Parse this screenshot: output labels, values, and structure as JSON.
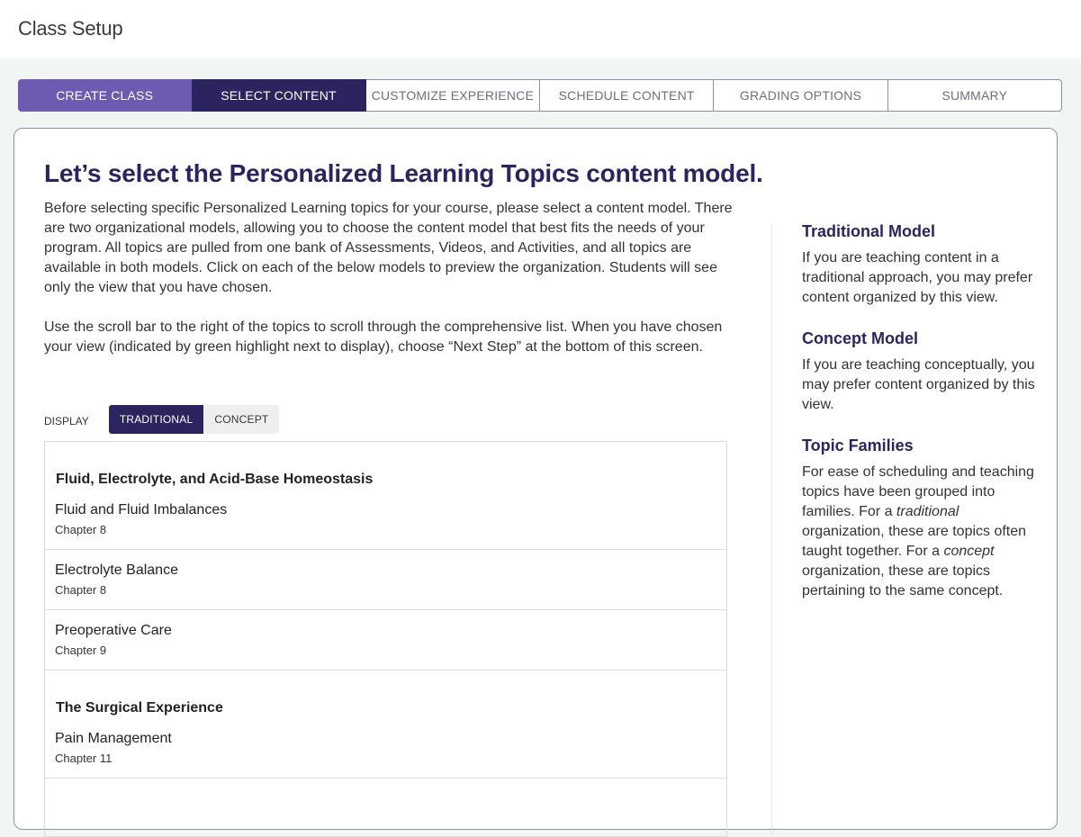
{
  "header": {
    "title": "Class Setup"
  },
  "stepper": {
    "steps": [
      {
        "label": "CREATE CLASS",
        "state": "done"
      },
      {
        "label": "SELECT CONTENT",
        "state": "active"
      },
      {
        "label": "CUSTOMIZE EXPERIENCE",
        "state": "upcoming"
      },
      {
        "label": "SCHEDULE CONTENT",
        "state": "upcoming"
      },
      {
        "label": "GRADING OPTIONS",
        "state": "upcoming"
      },
      {
        "label": "SUMMARY",
        "state": "upcoming"
      }
    ]
  },
  "main": {
    "title": "Let’s select the Personalized Learning Topics content model.",
    "intro_p1": "Before selecting specific Personalized Learning topics for your course, please select a content model. There are two organizational models, allowing you to choose the content model that best fits the needs of your program. All topics are pulled from one bank of Assessments, Videos, and Activities, and all topics are available in both models. Click on each of the below models to preview the  organization. Students will see only the view that you have chosen.",
    "intro_p2": "Use the scroll bar to the right of the topics to scroll through the comprehensive list. When you have chosen your view (indicated by green highlight next to display), choose “Next Step” at the bottom of this screen."
  },
  "display": {
    "label": "DISPLAY",
    "options": [
      "TRADITIONAL",
      "CONCEPT"
    ],
    "selected": "TRADITIONAL"
  },
  "topics": {
    "families": [
      {
        "title": "Fluid, Electrolyte, and Acid-Base Homeostasis",
        "items": [
          {
            "name": "Fluid and Fluid Imbalances",
            "chapter": "Chapter 8"
          },
          {
            "name": "Electrolyte Balance",
            "chapter": "Chapter 8"
          },
          {
            "name": "Preoperative Care",
            "chapter": "Chapter 9"
          }
        ]
      },
      {
        "title": "The Surgical Experience",
        "items": [
          {
            "name": "Pain Management",
            "chapter": "Chapter 11"
          }
        ]
      }
    ]
  },
  "sidebar": {
    "traditional": {
      "heading": "Traditional Model",
      "text": "If you are teaching content in a traditional approach, you may prefer content organized by this view."
    },
    "concept": {
      "heading": "Concept Model",
      "text": "If you are teaching conceptually, you may prefer content organized by this view."
    },
    "families": {
      "heading": "Topic Families",
      "text_1": "For ease of scheduling and teaching topics have been grouped into families. For a ",
      "em_1": "traditional",
      "text_2": " organization, these are topics often taught together. For a ",
      "em_2": "concept",
      "text_3": " organization, these are topics pertaining to the same concept."
    }
  },
  "colors": {
    "brand_dark": "#2b245e",
    "brand_light": "#6c5bb0",
    "background": "#f1f5f4"
  }
}
